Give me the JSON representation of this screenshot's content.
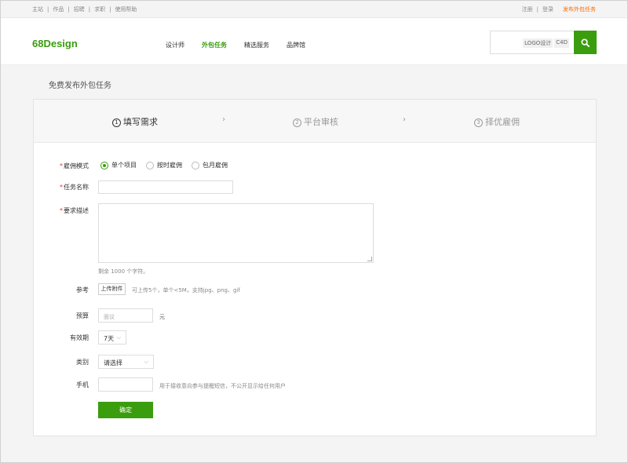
{
  "topbar": {
    "left_links": [
      "主站",
      "作品",
      "招聘",
      "求职",
      "使用帮助"
    ],
    "register": "注册",
    "sep": "|",
    "login": "登录",
    "publish": "发布外包任务"
  },
  "header": {
    "logo": "68Design",
    "nav": [
      {
        "label": "设计师",
        "active": false
      },
      {
        "label": "外包任务",
        "active": true
      },
      {
        "label": "精选服务",
        "active": false
      },
      {
        "label": "品牌馆",
        "active": false
      }
    ],
    "search_tags": [
      "LOGO设计",
      "C4D"
    ]
  },
  "page_title": "免费发布外包任务",
  "steps": [
    {
      "num": "1",
      "label": "填写需求",
      "active": true
    },
    {
      "num": "2",
      "label": "平台审核",
      "active": false
    },
    {
      "num": "3",
      "label": "择优雇佣",
      "active": false
    }
  ],
  "step_arrow": "›",
  "form": {
    "hire_mode_label": "雇佣模式",
    "hire_modes": [
      {
        "label": "单个项目",
        "checked": true
      },
      {
        "label": "按时雇佣",
        "checked": false
      },
      {
        "label": "包月雇佣",
        "checked": false
      }
    ],
    "task_name_label": "任务名称",
    "description_label": "要求描述",
    "char_remaining": "剩余 1000 个字符。",
    "reference_label": "参考",
    "upload_label": "上传附件",
    "upload_hint": "可上传5个，单个<5M，支持jpg、png、gif",
    "budget_label": "预算",
    "budget_placeholder": "面议",
    "budget_unit": "元",
    "validity_label": "有效期",
    "validity_value": "7天",
    "category_label": "类别",
    "category_value": "请选择",
    "phone_label": "手机",
    "phone_hint": "用于接收意向参与提醒短信，不公开显示给任何用户",
    "submit_label": "确定",
    "required_mark": "*"
  },
  "colors": {
    "brand": "#3a9d0e",
    "publish": "#ff6a00"
  }
}
